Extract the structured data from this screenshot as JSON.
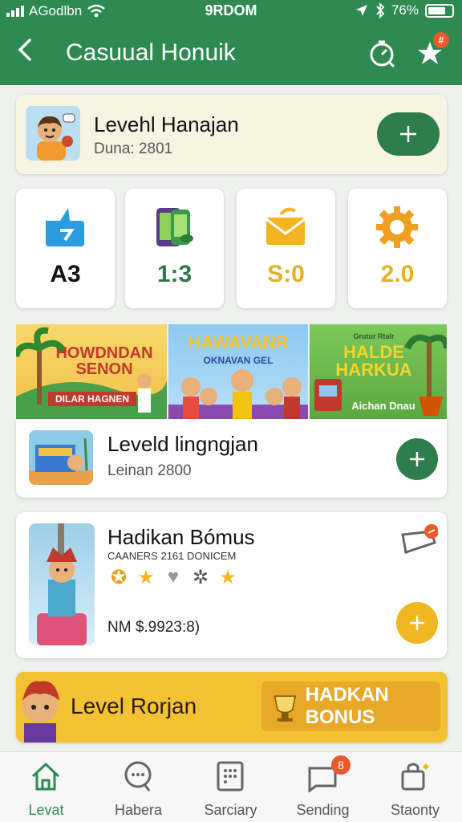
{
  "status_bar": {
    "carrier": "AGodlbn",
    "time": "9RDOM",
    "battery": "76%",
    "battery_fraction": 0.76
  },
  "header": {
    "title": "Casuual Honuik"
  },
  "level_card": {
    "title": "Levehl Hanajan",
    "subtitle": "Duna: 2801"
  },
  "stats": [
    {
      "value": "A3",
      "color": "#111111",
      "icon": "tag-icon"
    },
    {
      "value": "1:3",
      "color": "#2f7a4a",
      "icon": "phone-icon"
    },
    {
      "value": "S:0",
      "color": "#e8b020",
      "icon": "envelope-icon"
    },
    {
      "value": "2.0",
      "color": "#e8b020",
      "icon": "sun-gear-icon"
    }
  ],
  "banners": [
    {
      "title": "HOWDNDAN SENON",
      "subtitle": "DILAR HAGNEN"
    },
    {
      "title": "HAWAVANR",
      "subtitle": "OKNAVAN GEL"
    },
    {
      "title": "HALDE HARKUA",
      "subtitle": "Aichan Dnau",
      "tag": "Grutur Rtalr"
    }
  ],
  "level_card2": {
    "title": "Leveld lingngjan",
    "subtitle": "Leinan 2800"
  },
  "bonus_card": {
    "title": "Hadikan Bómus",
    "subtitle": "CAANERS 2161  DONICEM",
    "price": "NM $.9923:8)"
  },
  "promo": {
    "title": "Level Rorjan",
    "button": "HADKAN BONUS"
  },
  "nav": [
    {
      "label": "Levat",
      "icon": "home-icon",
      "active": true
    },
    {
      "label": "Habera",
      "icon": "chat-icon"
    },
    {
      "label": "Sarciary",
      "icon": "grid-icon"
    },
    {
      "label": "Sending",
      "icon": "message-icon",
      "badge": "8"
    },
    {
      "label": "Staonty",
      "icon": "bag-icon"
    }
  ],
  "colors": {
    "brand": "#2f8a52",
    "accent": "#f0b820",
    "badge": "#e85a2a"
  }
}
